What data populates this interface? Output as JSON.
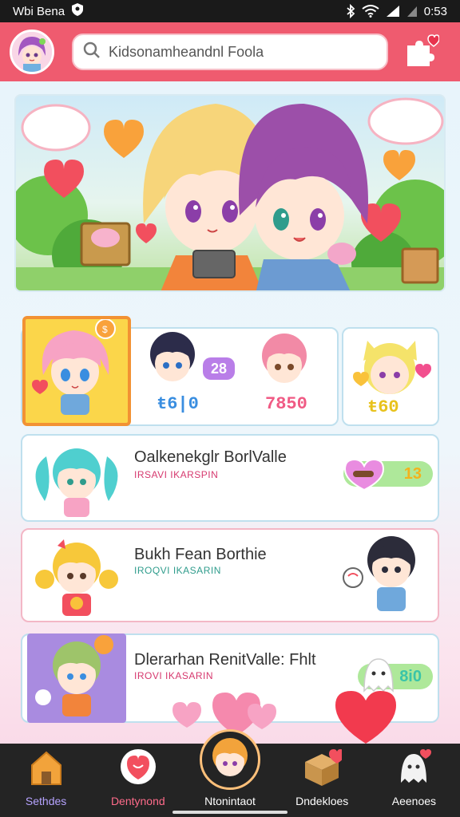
{
  "status_bar": {
    "carrier": "Wbi Bena",
    "time": "0:53"
  },
  "header": {
    "search_placeholder": "Kidsonamheandnl Foola"
  },
  "featured": {
    "pill_badge": "28",
    "count_left": "ŧ6|0",
    "count_right": "7850",
    "count_side": "ŧ60"
  },
  "list": [
    {
      "title": "Oalkenekglr BorlValle",
      "subtitle": "IRSAVI IKARSPIN",
      "badge": "13",
      "title_color": "#333"
    },
    {
      "title": "Bukh Fean Borthie",
      "subtitle": "IROQVI IKASARIN",
      "badge": "",
      "title_color": "#333"
    },
    {
      "title": "Dlerarhan RenitValle: Fhlt",
      "subtitle": "IROVI IKASARIN",
      "badge": "8i0",
      "title_color": "#333"
    }
  ],
  "nav": [
    {
      "label": "Sethdes",
      "icon": "house-icon"
    },
    {
      "label": "Dentynond",
      "icon": "heart-bubble-icon"
    },
    {
      "label": "Ntonintaot",
      "icon": "avatar-icon"
    },
    {
      "label": "Dndekloes",
      "icon": "box-icon"
    },
    {
      "label": "Aeenoes",
      "icon": "ghost-icon"
    }
  ],
  "colors": {
    "header": "#ef5b6f",
    "accent_pink": "#ff6b8a",
    "nav_bg": "#242424"
  }
}
